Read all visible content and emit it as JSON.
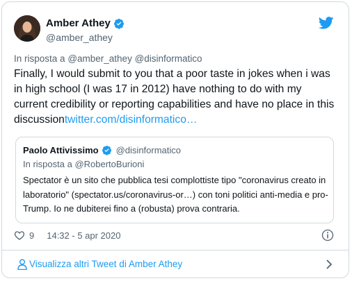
{
  "author": {
    "name": "Amber Athey",
    "handle": "@amber_athey"
  },
  "tweet": {
    "reply_prefix": "In risposta a",
    "reply_mentions": "@amber_athey @disinformatico",
    "text": "Finally, I would submit to you that a poor taste in jokes when i was in high school (I was 17 in 2012) have nothing to do with my current credibility or reporting capabilities and have no place in this discussion",
    "link_text": "twitter.com/disinformatico…"
  },
  "quote": {
    "name": "Paolo Attivissimo",
    "handle": "@disinformatico",
    "reply_prefix": "In risposta a",
    "reply_mention": "@RobertoBurioni",
    "text": "Spectator è un sito che pubblica tesi complottiste tipo \"coronavirus creato in laboratorio\" (spectator.us/coronavirus-or…) con toni politici anti-media e pro-Trump. Io ne dubiterei fino a (robusta) prova contraria."
  },
  "meta": {
    "likes": "9",
    "timestamp": "14:32 - 5 apr 2020"
  },
  "footer": {
    "more_tweets_label": "Visualizza altri Tweet di Amber Athey"
  },
  "colors": {
    "accent": "#1d9bf0",
    "text": "#0f1419",
    "secondary": "#536471",
    "border": "#cfd9de"
  }
}
